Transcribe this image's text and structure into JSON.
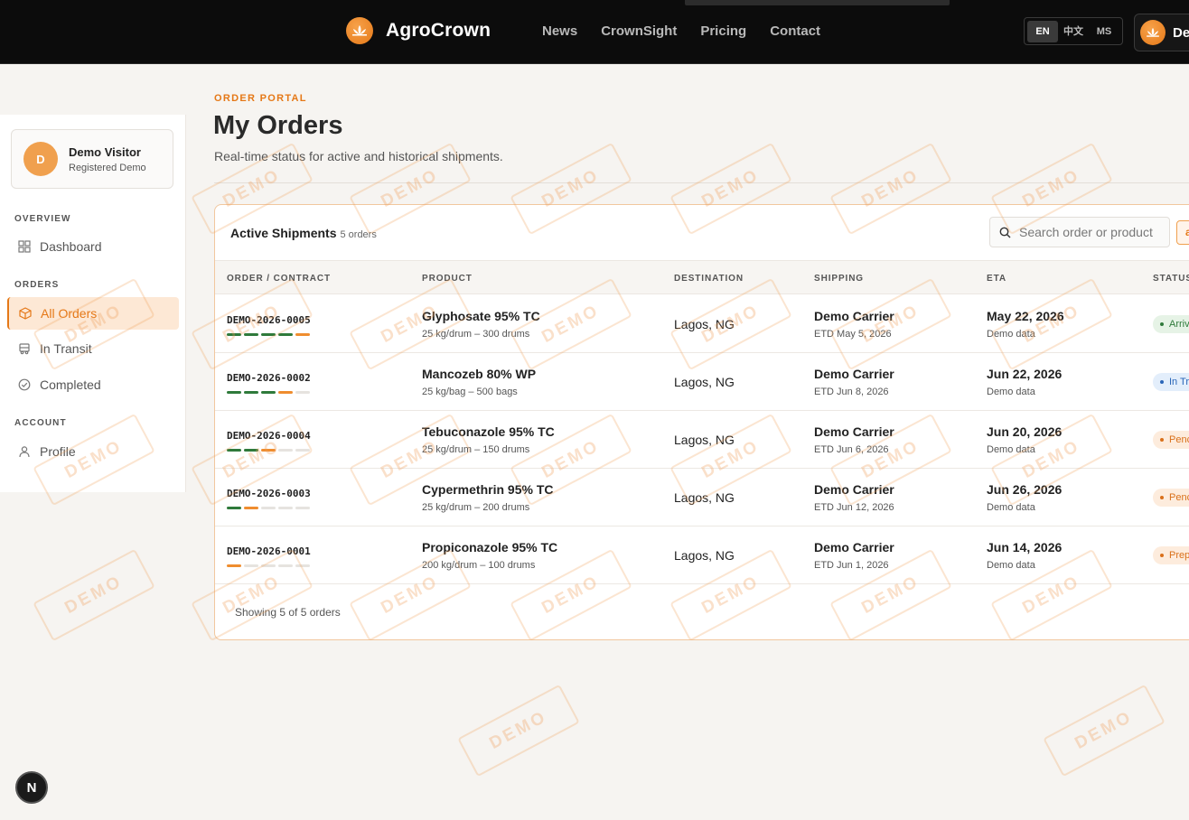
{
  "header": {
    "brand": "AgroCrown",
    "nav": [
      "News",
      "CrownSight",
      "Pricing",
      "Contact"
    ],
    "languages": [
      "EN",
      "中文",
      "MS"
    ],
    "active_language": "EN",
    "user_label": "De"
  },
  "sidebar": {
    "profile": {
      "initial": "D",
      "name": "Demo Visitor",
      "role": "Registered Demo"
    },
    "sections": {
      "overview": "OVERVIEW",
      "orders": "ORDERS",
      "account": "ACCOUNT"
    },
    "items": {
      "dashboard": "Dashboard",
      "all_orders": "All Orders",
      "in_transit": "In Transit",
      "completed": "Completed",
      "profile": "Profile"
    }
  },
  "page": {
    "eyebrow": "ORDER PORTAL",
    "title": "My Orders",
    "subtitle": "Real-time status for active and historical shipments."
  },
  "table": {
    "title": "Active Shipments",
    "count": "5 orders",
    "search_placeholder": "Search order or product",
    "filter_label": "a",
    "columns": [
      "ORDER / CONTRACT",
      "PRODUCT",
      "DESTINATION",
      "SHIPPING",
      "ETA",
      "STATUS"
    ],
    "rows": [
      {
        "id": "DEMO-2026-0005",
        "progress": [
          2,
          2,
          2,
          2,
          1
        ],
        "product": "Glyphosate 95% TC",
        "pack": "25 kg/drum – 300 drums",
        "destination": "Lagos, NG",
        "carrier": "Demo Carrier",
        "etd": "ETD May 5, 2026",
        "eta": "May 22, 2026",
        "eta_note": "Demo data",
        "status": "Arriv",
        "status_kind": "arrived"
      },
      {
        "id": "DEMO-2026-0002",
        "progress": [
          2,
          2,
          2,
          1,
          0
        ],
        "product": "Mancozeb 80% WP",
        "pack": "25 kg/bag – 500 bags",
        "destination": "Lagos, NG",
        "carrier": "Demo Carrier",
        "etd": "ETD Jun 8, 2026",
        "eta": "Jun 22, 2026",
        "eta_note": "Demo data",
        "status": "In Tr",
        "status_kind": "transit"
      },
      {
        "id": "DEMO-2026-0004",
        "progress": [
          2,
          2,
          1,
          0,
          0
        ],
        "product": "Tebuconazole 95% TC",
        "pack": "25 kg/drum – 150 drums",
        "destination": "Lagos, NG",
        "carrier": "Demo Carrier",
        "etd": "ETD Jun 6, 2026",
        "eta": "Jun 20, 2026",
        "eta_note": "Demo data",
        "status": "Penc",
        "status_kind": "pending"
      },
      {
        "id": "DEMO-2026-0003",
        "progress": [
          2,
          1,
          0,
          0,
          0
        ],
        "product": "Cypermethrin 95% TC",
        "pack": "25 kg/drum – 200 drums",
        "destination": "Lagos, NG",
        "carrier": "Demo Carrier",
        "etd": "ETD Jun 12, 2026",
        "eta": "Jun 26, 2026",
        "eta_note": "Demo data",
        "status": "Penc",
        "status_kind": "pending"
      },
      {
        "id": "DEMO-2026-0001",
        "progress": [
          1,
          0,
          0,
          0,
          0
        ],
        "product": "Propiconazole 95% TC",
        "pack": "200 kg/drum – 100 drums",
        "destination": "Lagos, NG",
        "carrier": "Demo Carrier",
        "etd": "ETD Jun 1, 2026",
        "eta": "Jun 14, 2026",
        "eta_note": "Demo data",
        "status": "Prep",
        "status_kind": "prep"
      }
    ],
    "footer": "Showing 5 of 5 orders"
  },
  "watermark": "DEMO",
  "fab_label": "N",
  "colors": {
    "accent": "#e57817",
    "done": "#2f7a3b",
    "topbar": "#0c0c0c"
  }
}
